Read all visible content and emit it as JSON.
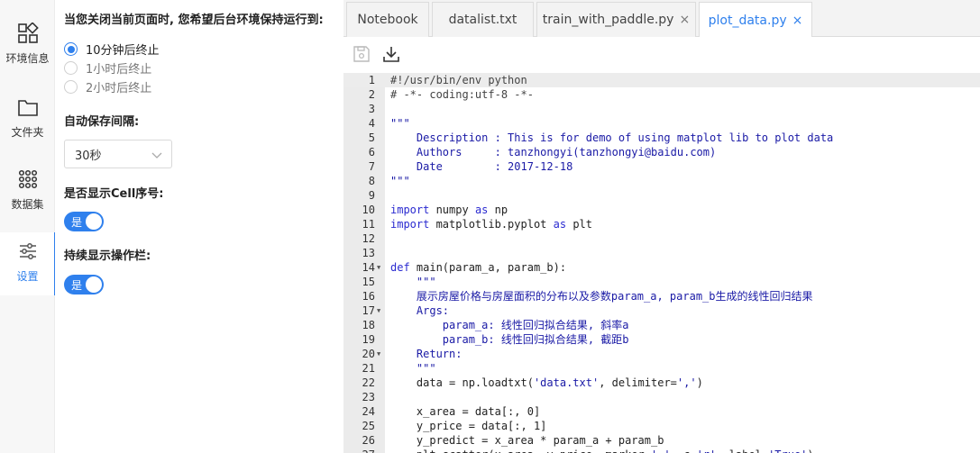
{
  "sidebar": {
    "items": [
      {
        "label": "环境信息",
        "icon": "grid-icon"
      },
      {
        "label": "文件夹",
        "icon": "folder-icon"
      },
      {
        "label": "数据集",
        "icon": "dots-grid-icon"
      },
      {
        "label": "设置",
        "icon": "sliders-icon",
        "active": true
      }
    ]
  },
  "settings": {
    "close_title": "当您关闭当前页面时, 您希望后台环境保持运行到:",
    "close_options": [
      "10分钟后终止",
      "1小时后终止",
      "2小时后终止"
    ],
    "close_selected": 0,
    "autosave_title": "自动保存间隔:",
    "autosave_value": "30秒",
    "cell_title": "是否显示Cell序号:",
    "cell_toggle": "是",
    "toolbar_title": "持续显示操作栏:",
    "toolbar_toggle": "是"
  },
  "tabs": [
    {
      "label": "Notebook",
      "closable": false
    },
    {
      "label": "datalist.txt",
      "closable": false
    },
    {
      "label": "train_with_paddle.py",
      "closable": true
    },
    {
      "label": "plot_data.py",
      "closable": true,
      "active": true
    }
  ],
  "toolbar": {
    "buttons": [
      "save-icon",
      "download-icon"
    ]
  },
  "accent": "#2f80ed",
  "editor": {
    "lines": [
      {
        "n": "1",
        "text": "#!/usr/bin/env python",
        "hl": true
      },
      {
        "n": "2",
        "text": "# -*- coding:utf-8 -*-"
      },
      {
        "n": "3",
        "text": ""
      },
      {
        "n": "4",
        "text": "\"\"\""
      },
      {
        "n": "5",
        "text": "    Description : This is for demo of using matplot lib to plot data"
      },
      {
        "n": "6",
        "text": "    Authors     : tanzhongyi(tanzhongyi@baidu.com)"
      },
      {
        "n": "7",
        "text": "    Date        : 2017-12-18"
      },
      {
        "n": "8",
        "text": "\"\"\""
      },
      {
        "n": "9",
        "text": ""
      },
      {
        "n": "10",
        "text": "import numpy as np"
      },
      {
        "n": "11",
        "text": "import matplotlib.pyplot as plt"
      },
      {
        "n": "12",
        "text": ""
      },
      {
        "n": "13",
        "text": ""
      },
      {
        "n": "14",
        "text": "def main(param_a, param_b):",
        "fold": true
      },
      {
        "n": "15",
        "text": "    \"\"\""
      },
      {
        "n": "16",
        "text": "    展示房屋价格与房屋面积的分布以及参数param_a, param_b生成的线性回归结果"
      },
      {
        "n": "17",
        "text": "    Args:",
        "fold": true
      },
      {
        "n": "18",
        "text": "        param_a: 线性回归拟合结果, 斜率a"
      },
      {
        "n": "19",
        "text": "        param_b: 线性回归拟合结果, 截距b"
      },
      {
        "n": "20",
        "text": "    Return:",
        "fold": true
      },
      {
        "n": "21",
        "text": "    \"\"\""
      },
      {
        "n": "22",
        "text": "    data = np.loadtxt('data.txt', delimiter=',')"
      },
      {
        "n": "23",
        "text": ""
      },
      {
        "n": "24",
        "text": "    x_area = data[:, 0]"
      },
      {
        "n": "25",
        "text": "    y_price = data[:, 1]"
      },
      {
        "n": "26",
        "text": "    y_predict = x_area * param_a + param_b"
      },
      {
        "n": "27",
        "text": "    plt.scatter(x_area, y_price, marker='.', c='r', label='True')"
      }
    ]
  }
}
